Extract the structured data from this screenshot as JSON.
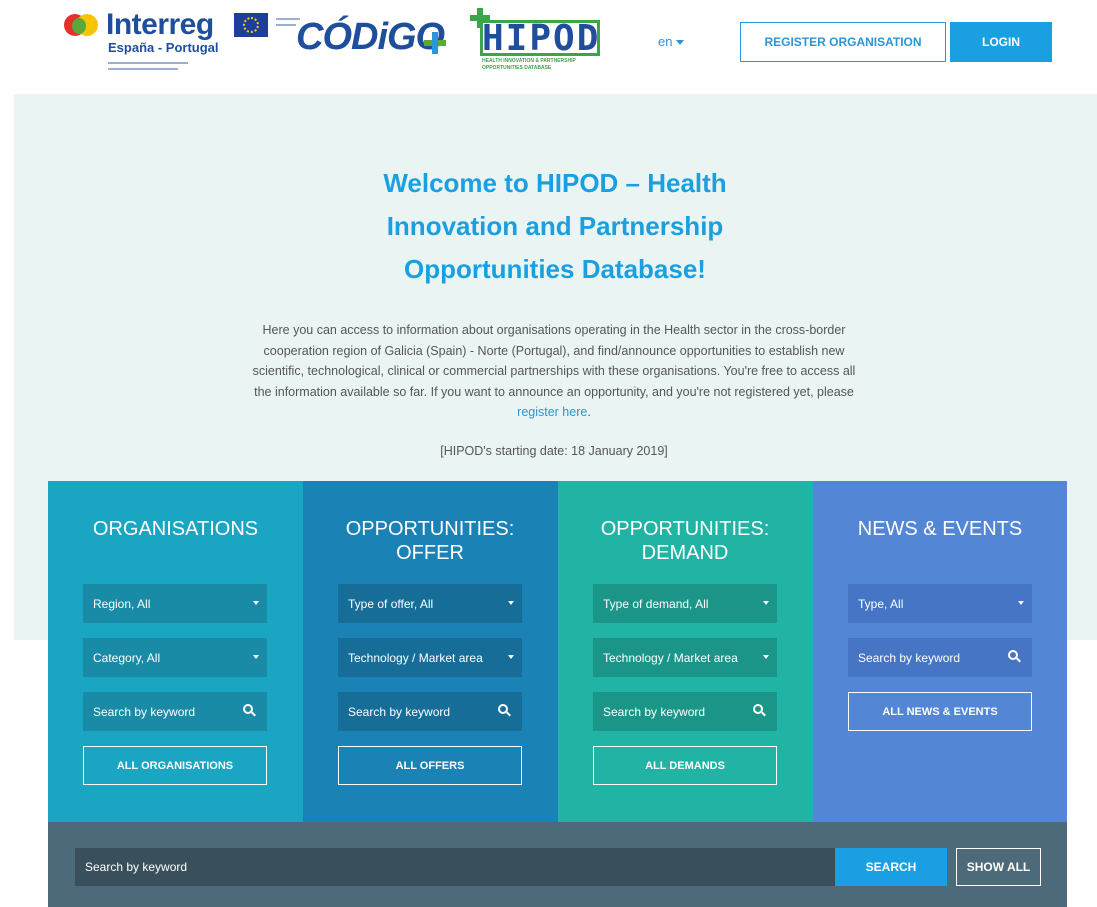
{
  "header": {
    "interreg": {
      "word": "Interreg",
      "sub": "España - Portugal"
    },
    "codigo": {
      "word": "CÓDiGO"
    },
    "hipod": {
      "word": "HIPOD",
      "tag1": "HEALTH INNOVATION & PARTNERSHIP",
      "tag2": "OPPORTUNITIES DATABASE"
    },
    "language": "en",
    "register_label": "REGISTER ORGANISATION",
    "login_label": "LOGIN"
  },
  "hero": {
    "title": "Welcome to HIPOD – Health Innovation and Partnership Opportunities Database!",
    "intro": "Here you can access to information about organisations operating in the Health sector in the cross-border cooperation region of Galicia (Spain) - Norte (Portugal), and find/announce opportunities to establish new scientific, technological, clinical or commercial partnerships with these organisations. You're free to access all the information available so far. If you want to announce an opportunity, and you're not registered yet, please",
    "register_link": "register here",
    "intro_end": ".",
    "start_date": "[HIPOD's starting date: 18 January 2019]"
  },
  "panels": {
    "organisations": {
      "title": "ORGANISATIONS",
      "region": "Region, All",
      "category": "Category, All",
      "search_placeholder": "Search by keyword",
      "all_label": "ALL ORGANISATIONS"
    },
    "offer": {
      "title": "OPPORTUNITIES: OFFER",
      "type": "Type of offer, All",
      "area": "Technology / Market area",
      "search_placeholder": "Search by keyword",
      "all_label": "ALL OFFERS"
    },
    "demand": {
      "title": "OPPORTUNITIES: DEMAND",
      "type": "Type of demand, All",
      "area": "Technology / Market area",
      "search_placeholder": "Search by keyword",
      "all_label": "ALL DEMANDS"
    },
    "news": {
      "title": "NEWS & EVENTS",
      "type": "Type, All",
      "search_placeholder": "Search by keyword",
      "all_label": "ALL NEWS & EVENTS"
    }
  },
  "bottom": {
    "search_placeholder": "Search by keyword",
    "search_label": "SEARCH",
    "show_all_label": "SHOW ALL"
  },
  "colors": {
    "accent": "#1a9fe3",
    "panel_organisations": "#1aa5c2",
    "panel_offer": "#1a82b5",
    "panel_demand": "#21b3a3",
    "panel_news": "#5486d6",
    "bottom_bar": "#4d6a7a"
  }
}
